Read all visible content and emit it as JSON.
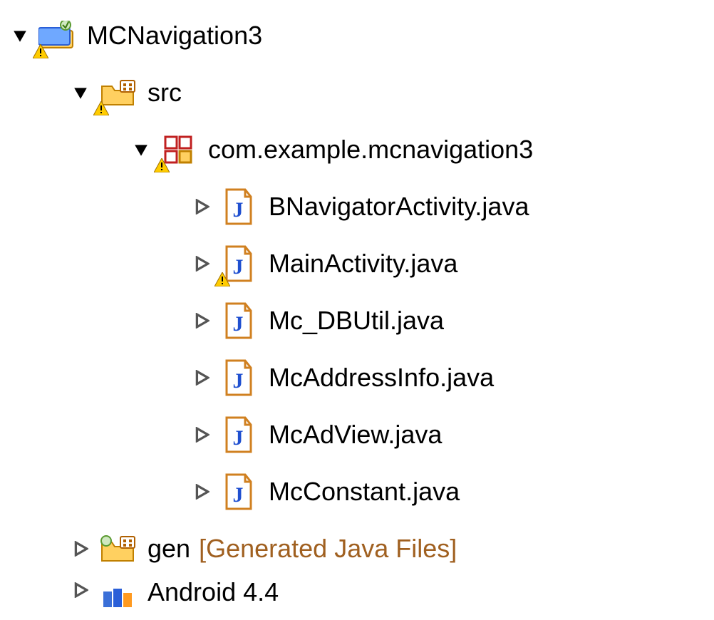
{
  "tree": {
    "project": {
      "label": "MCNavigation3",
      "src": {
        "label": "src",
        "pkg": {
          "label": "com.example.mcnavigation3",
          "files": [
            {
              "label": "BNavigatorActivity.java",
              "warning": false
            },
            {
              "label": "MainActivity.java",
              "warning": true
            },
            {
              "label": "Mc_DBUtil.java",
              "warning": false
            },
            {
              "label": "McAddressInfo.java",
              "warning": false
            },
            {
              "label": "McAdView.java",
              "warning": false
            },
            {
              "label": "McConstant.java",
              "warning": false
            }
          ]
        }
      },
      "gen": {
        "label": "gen",
        "suffix": "[Generated Java Files]"
      },
      "android": {
        "label": "Android 4.4"
      }
    }
  }
}
